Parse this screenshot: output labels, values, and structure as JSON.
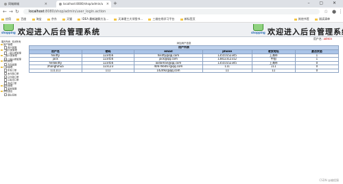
{
  "browser": {
    "tabs": [
      {
        "title": "同城商城",
        "active": false
      },
      {
        "title": "localhost:8080/shop/admin/u",
        "active": true
      }
    ],
    "new_tab": "+",
    "window_controls": "–  ▢  ✕",
    "url_host": "localhost",
    "url_path": ":8080/shop/admin/user_login.action",
    "bookmarks": [
      "应用",
      "百度",
      "淘宝",
      "京东",
      "天猫",
      "IDEA 最新破解方法...",
      "天津理工大学图书...",
      "三维在线学习平台",
      "新标签页"
    ],
    "bookmarks_right": [
      "其他书签",
      "阅读清单"
    ]
  },
  "header": {
    "logo_text": "shopping",
    "title": "欢迎进入后台管理系统"
  },
  "userbar": {
    "label": "用户名:",
    "username": "admin"
  },
  "leftnav": {
    "top_links": [
      "展开所有",
      "关闭所有"
    ],
    "tree": [
      {
        "type": "group",
        "label": "用户管理"
      },
      {
        "type": "item",
        "label": "用户管理"
      },
      {
        "type": "group",
        "label": "一级分类管理"
      },
      {
        "type": "item",
        "label": "一级分类管理"
      },
      {
        "type": "group",
        "label": "二级分类管理"
      },
      {
        "type": "item",
        "label": "二级分类管理"
      },
      {
        "type": "group",
        "label": "商品管理"
      },
      {
        "type": "item",
        "label": "商品管理"
      },
      {
        "type": "group",
        "label": "订单管理"
      },
      {
        "type": "item",
        "label": "所有订单"
      },
      {
        "type": "item",
        "label": "未付款订单"
      },
      {
        "type": "item",
        "label": "已付款订单"
      },
      {
        "type": "item",
        "label": "已发货订单"
      },
      {
        "type": "item",
        "label": "完成订单"
      },
      {
        "type": "group",
        "label": "留言管理"
      },
      {
        "type": "item",
        "label": "留言管理"
      },
      {
        "type": "group",
        "label": "系统退出"
      },
      {
        "type": "item",
        "label": "退出系统"
      }
    ]
  },
  "table": {
    "caption": "添加用户信息",
    "title": "用户列表",
    "columns": [
      "用户名",
      "密码",
      "email",
      "phone",
      "收货地址",
      "激活状态"
    ],
    "rows": [
      [
        "hikitty",
        "123456",
        "hikitty@qq.com",
        "13555552345",
        "上海市",
        "1"
      ],
      [
        "jack",
        "123456",
        "jack@qq.com",
        "13812312312",
        "中国",
        "1"
      ],
      [
        "hellokitty",
        "123456",
        "aodaman@qq.com",
        "13555552345",
        "上海市",
        "0"
      ],
      [
        "zhangfuhua",
        "123123",
        "406766467@qq.com",
        "111",
        "111",
        "0"
      ],
      [
        "111111",
        "111",
        "142492@qq.com",
        "11",
        "11",
        "0"
      ]
    ]
  },
  "watermark": "CSDN @编程猿"
}
